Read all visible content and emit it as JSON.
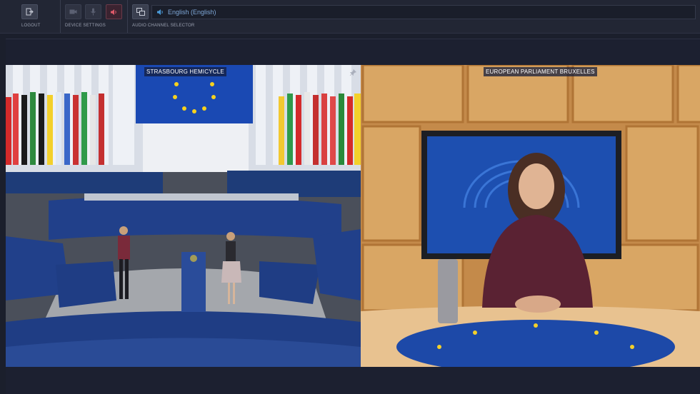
{
  "toolbar": {
    "logout_label": "LOGOUT",
    "device_settings_label": "DEVICE SETTINGS",
    "audio_channel_label": "AUDIO CHANNEL SELECTOR",
    "audio_channel_value": "English (English)"
  },
  "icons": {
    "logout": "logout-icon",
    "camera": "camera-icon",
    "microphone": "microphone-icon",
    "speaker": "speaker-icon",
    "language": "language-icon",
    "audio": "audio-wave-icon",
    "pin": "pin-icon"
  },
  "videos": [
    {
      "label": "STRASBOURG HEMICYCLE"
    },
    {
      "label": "EUROPEAN PARLIAMENT BRUXELLES"
    }
  ],
  "colors": {
    "accent": "#7fa8d8",
    "speaker_active": "#e05a6a",
    "toolbar_bg": "#222634",
    "page_bg": "#1b1f2c"
  }
}
